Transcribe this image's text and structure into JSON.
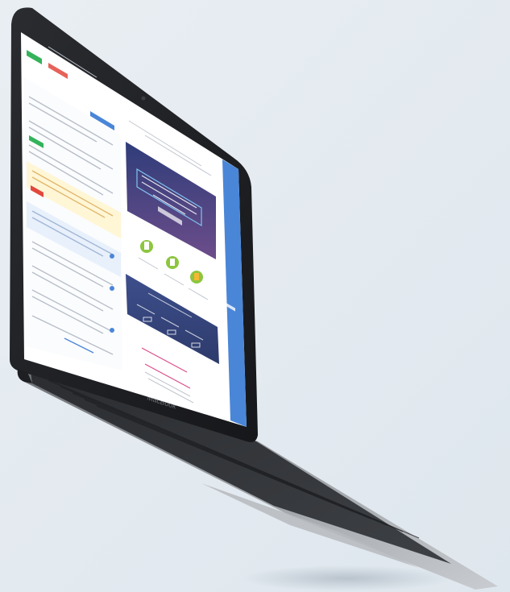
{
  "scene": {
    "subject": "laptop",
    "brand_color": "#3a7bd5",
    "accent_green": "#34b35a",
    "accent_red": "#e2483d"
  },
  "screen": {
    "app_ui": {
      "primary_color": "#4a86d8",
      "highlight_color": "#fff6d6",
      "badge_colors": [
        "#34b35a",
        "#e2483d",
        "#4a86d8"
      ]
    }
  }
}
